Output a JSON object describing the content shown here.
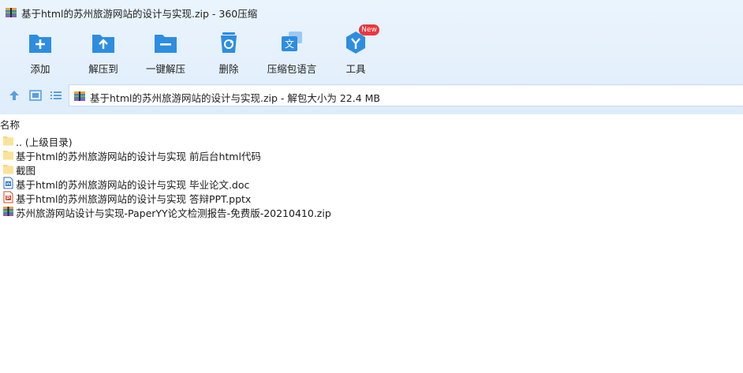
{
  "window": {
    "title": "基于html的苏州旅游网站的设计与实现.zip - 360压缩"
  },
  "toolbar": {
    "add": "添加",
    "extract_to": "解压到",
    "one_click_extract": "一键解压",
    "delete": "删除",
    "language": "压缩包语言",
    "tools": "工具",
    "tools_badge": "New"
  },
  "address": {
    "text": "基于html的苏州旅游网站的设计与实现.zip - 解包大小为 22.4 MB"
  },
  "list": {
    "header_name": "名称",
    "rows": [
      {
        "label": ".. (上级目录)",
        "icon": "folder-icon"
      },
      {
        "label": "基于html的苏州旅游网站的设计与实现 前后台html代码",
        "icon": "folder-icon"
      },
      {
        "label": "截图",
        "icon": "folder-icon"
      },
      {
        "label": "基于html的苏州旅游网站的设计与实现 毕业论文.doc",
        "icon": "word-doc-icon"
      },
      {
        "label": "基于html的苏州旅游网站的设计与实现 答辩PPT.pptx",
        "icon": "powerpoint-icon"
      },
      {
        "label": "苏州旅游网站设计与实现-PaperYY论文检测报告-免费版-20210410.zip",
        "icon": "zip-archive-icon"
      }
    ]
  },
  "colors": {
    "accent": "#2e8de0",
    "badge": "#e9383d",
    "folder": "#f7d679"
  }
}
